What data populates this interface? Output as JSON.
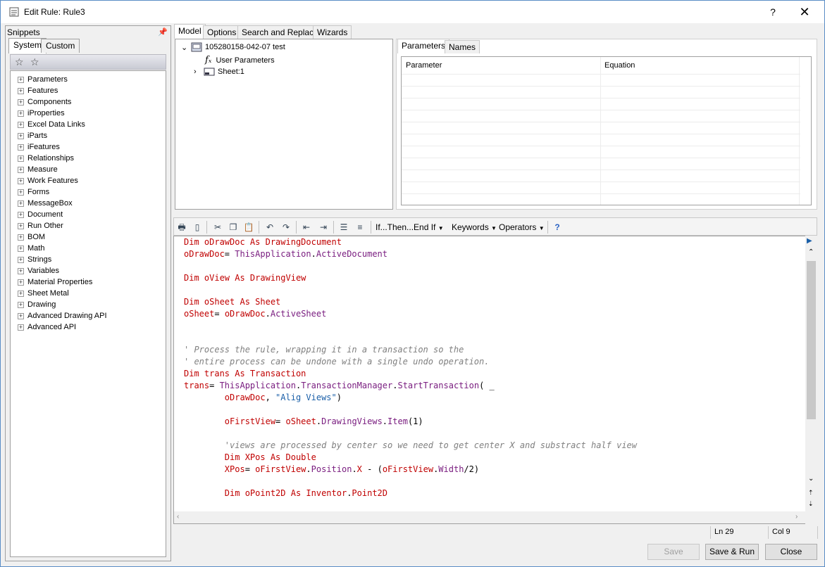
{
  "window": {
    "title": "Edit Rule: Rule3",
    "help_label": "?",
    "close_label": "✕"
  },
  "snippets": {
    "header": "Snippets",
    "tabs": [
      "System",
      "Custom"
    ],
    "items": [
      "Parameters",
      "Features",
      "Components",
      "iProperties",
      "Excel Data Links",
      "iParts",
      "iFeatures",
      "Relationships",
      "Measure",
      "Work Features",
      "Forms",
      "MessageBox",
      "Document",
      "Run Other",
      "BOM",
      "Math",
      "Strings",
      "Variables",
      "Material Properties",
      "Sheet Metal",
      "Drawing",
      "Advanced Drawing API",
      "Advanced API"
    ]
  },
  "main_tabs": [
    "Model",
    "Options",
    "Search and Replace",
    "Wizards"
  ],
  "model_tree": {
    "root": "105280158-042-07 test",
    "children": [
      "User Parameters",
      "Sheet:1"
    ]
  },
  "param_tabs": [
    "Parameters",
    "Names"
  ],
  "param_grid": {
    "columns": [
      "Parameter",
      "Equation"
    ]
  },
  "toolbar": {
    "menus": [
      "If...Then...End If",
      "Keywords",
      "Operators"
    ]
  },
  "code_lines": [
    [
      [
        "kw",
        "Dim oDrawDoc As DrawingDocument"
      ]
    ],
    [
      [
        "kw",
        "oDrawDoc"
      ],
      [
        "",
        "= "
      ],
      [
        "fn",
        "ThisApplication"
      ],
      [
        "",
        "."
      ],
      [
        "fn",
        "ActiveDocument"
      ]
    ],
    [],
    [
      [
        "kw",
        "Dim oView As DrawingView"
      ]
    ],
    [],
    [
      [
        "kw",
        "Dim oSheet As Sheet"
      ]
    ],
    [
      [
        "kw",
        "oSheet"
      ],
      [
        "",
        "= "
      ],
      [
        "kw",
        "oDrawDoc"
      ],
      [
        "",
        "."
      ],
      [
        "fn",
        "ActiveSheet"
      ]
    ],
    [],
    [],
    [
      [
        "cm",
        "' Process the rule, wrapping it in a transaction so the"
      ]
    ],
    [
      [
        "cm",
        "' entire process can be undone with a single undo operation."
      ]
    ],
    [
      [
        "kw",
        "Dim trans As Transaction"
      ]
    ],
    [
      [
        "kw",
        "trans"
      ],
      [
        "",
        "= "
      ],
      [
        "fn",
        "ThisApplication"
      ],
      [
        "",
        "."
      ],
      [
        "fn",
        "TransactionManager"
      ],
      [
        "",
        "."
      ],
      [
        "fn",
        "StartTransaction"
      ],
      [
        "",
        "( _"
      ]
    ],
    [
      [
        "",
        "        "
      ],
      [
        "kw",
        "oDrawDoc"
      ],
      [
        "",
        ", "
      ],
      [
        "str",
        "\"Alig Views\""
      ],
      [
        "",
        ")"
      ]
    ],
    [],
    [
      [
        "",
        "        "
      ],
      [
        "kw",
        "oFirstView"
      ],
      [
        "",
        ""
      ],
      [
        "",
        "= "
      ],
      [
        "kw",
        "oSheet"
      ],
      [
        "",
        "."
      ],
      [
        "fn",
        "DrawingViews"
      ],
      [
        "",
        "."
      ],
      [
        "fn",
        "Item"
      ],
      [
        "",
        "(1)"
      ]
    ],
    [],
    [
      [
        "",
        "        "
      ],
      [
        "cm",
        "'views are processed by center so we need to get center X and substract half view"
      ]
    ],
    [
      [
        "",
        "        "
      ],
      [
        "kw",
        "Dim XPos As Double"
      ]
    ],
    [
      [
        "",
        "        "
      ],
      [
        "kw",
        "XPos"
      ],
      [
        "",
        "= "
      ],
      [
        "kw",
        "oFirstView"
      ],
      [
        "",
        "."
      ],
      [
        "fn",
        "Position"
      ],
      [
        "",
        "."
      ],
      [
        "kw",
        "X"
      ],
      [
        "",
        " - ("
      ],
      [
        "kw",
        "oFirstView"
      ],
      [
        "",
        "."
      ],
      [
        "fn",
        "Width"
      ],
      [
        "",
        "/2)"
      ]
    ],
    [],
    [
      [
        "",
        "        "
      ],
      [
        "kw",
        "Dim oPoint2D As Inventor"
      ],
      [
        "",
        "."
      ],
      [
        "kw",
        "Point2D"
      ]
    ]
  ],
  "status": {
    "line": "Ln 29",
    "col": "Col 9"
  },
  "buttons": {
    "save": "Save",
    "save_run": "Save & Run",
    "close": "Close"
  }
}
